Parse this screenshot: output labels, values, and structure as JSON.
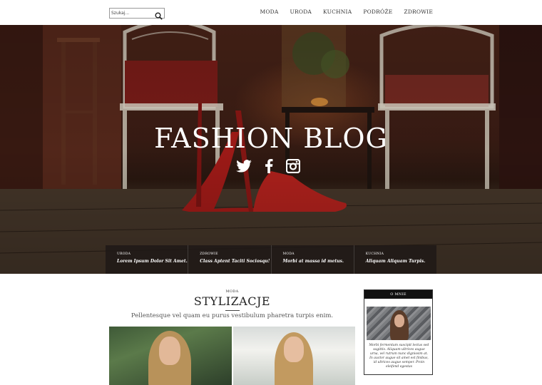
{
  "search": {
    "placeholder": "Szukaj..."
  },
  "nav": [
    "MODA",
    "URODA",
    "KUCHNIA",
    "PODRÓŻE",
    "ZDROWIE"
  ],
  "hero": {
    "title": "FASHION BLOG",
    "social": [
      "twitter-icon",
      "facebook-icon",
      "instagram-icon"
    ]
  },
  "featured": [
    {
      "category": "URODA",
      "title": "Lorem Ipsum Dolor Sit Amet."
    },
    {
      "category": "ZDROWIE",
      "title": "Class Aptent Taciti Sociosqu!"
    },
    {
      "category": "MODA",
      "title": "Morbi at massa id metus."
    },
    {
      "category": "KUCHNIA",
      "title": "Aliquam Aliquam Turpis."
    }
  ],
  "post": {
    "category": "MODA",
    "title": "STYLIZACJE",
    "excerpt": "Pellentesque vel quam eu purus vestibulum pharetra turpis enim."
  },
  "about": {
    "heading": "O MNIE",
    "bio": "Morbi fermentum suscipit lectus sed sagittis. Aliquam ultrices augue urna, vel rutrum nunc dignissim at. In auctor augue sit amet est finibus, id ultrices augue semper. Proin eleifend egestas"
  }
}
